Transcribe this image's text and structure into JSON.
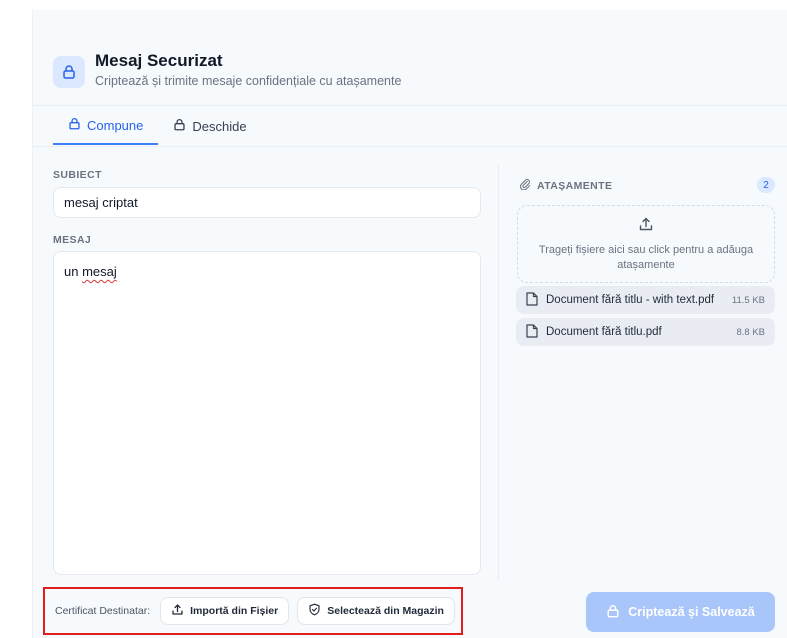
{
  "app": {
    "title": "Mesaj Securizat",
    "subtitle": "Criptează și trimite mesaje confidențiale cu atașamente"
  },
  "tabs": [
    {
      "label": "Compune",
      "active": true,
      "icon": "lock-open-icon"
    },
    {
      "label": "Deschide",
      "active": false,
      "icon": "lock-open-icon"
    }
  ],
  "compose": {
    "subject_label": "SUBIECT",
    "subject_value": "mesaj criptat",
    "message_label": "MESAJ",
    "message_prefix": "un ",
    "message_misspelled": "mesaj"
  },
  "attachments": {
    "label": "ATAȘAMENTE",
    "count": "2",
    "dropzone_text": "Trageți fișiere aici sau click pentru a adăuga atașamente",
    "files": [
      {
        "name": "Document fără titlu - with text.pdf",
        "size": "11.5 KB"
      },
      {
        "name": "Document fără titlu.pdf",
        "size": "8.8 KB"
      }
    ]
  },
  "footer": {
    "certificate_label": "Certificat Destinatar:",
    "import_label": "Importă din Fișier",
    "select_label": "Selectează din Magazin",
    "submit_label": "Criptează și Salvează"
  },
  "colors": {
    "accent": "#2563eb",
    "primary_disabled": "#a9c6fb",
    "highlight_border": "#e11d1d"
  }
}
